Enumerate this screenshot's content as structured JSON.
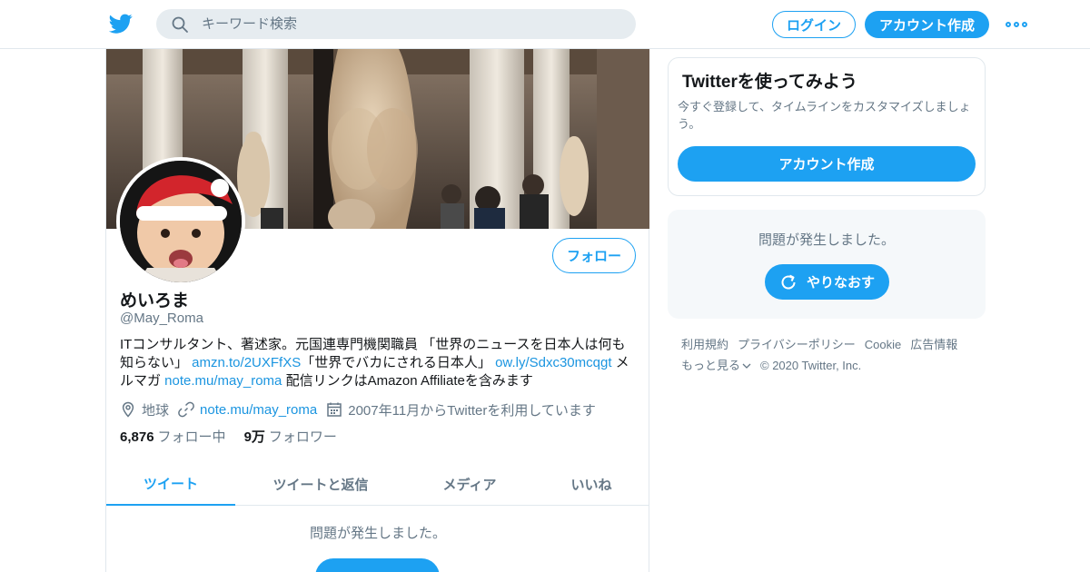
{
  "header": {
    "logo_icon": "twitter-bird-icon",
    "search_placeholder": "キーワード検索",
    "login_label": "ログイン",
    "signup_label": "アカウント作成",
    "more_icon": "more-dots-icon"
  },
  "profile": {
    "follow_label": "フォロー",
    "display_name": "めいろま",
    "handle": "@May_Roma",
    "bio": {
      "t1": "ITコンサルタント、著述家。元国連専門機関職員 「世界のニュースを日本人は何も知らない」 ",
      "link1": "amzn.to/2UXFfXS",
      "t2": "「世界でバカにされる日本人」 ",
      "link2": "ow.ly/Sdxc30mcqgt",
      "t3": " メルマガ ",
      "link3": "note.mu/may_roma",
      "t4": " 配信リンクはAmazon Affiliateを含みます"
    },
    "meta": {
      "location": "地球",
      "website": "note.mu/may_roma",
      "joined": "2007年11月からTwitterを利用しています"
    },
    "stats": {
      "following_count": "6,876",
      "following_label": "フォロー中",
      "followers_count": "9万",
      "followers_label": "フォロワー"
    },
    "tabs": [
      "ツイート",
      "ツイートと返信",
      "メディア",
      "いいね"
    ],
    "timeline_error": "問題が発生しました。"
  },
  "sidebar": {
    "signup_card": {
      "title": "Twitterを使ってみよう",
      "description": "今すぐ登録して、タイムラインをカスタマイズしましょう。",
      "cta": "アカウント作成"
    },
    "error_card": {
      "message": "問題が発生しました。",
      "retry_label": "やりなおす"
    },
    "footer": {
      "terms": "利用規約",
      "privacy": "プライバシーポリシー",
      "cookie": "Cookie",
      "ads": "広告情報",
      "more": "もっと見る",
      "copyright": "© 2020 Twitter, Inc."
    }
  },
  "colors": {
    "brand": "#1da1f2",
    "link": "#1b95e0",
    "muted": "#657786"
  }
}
